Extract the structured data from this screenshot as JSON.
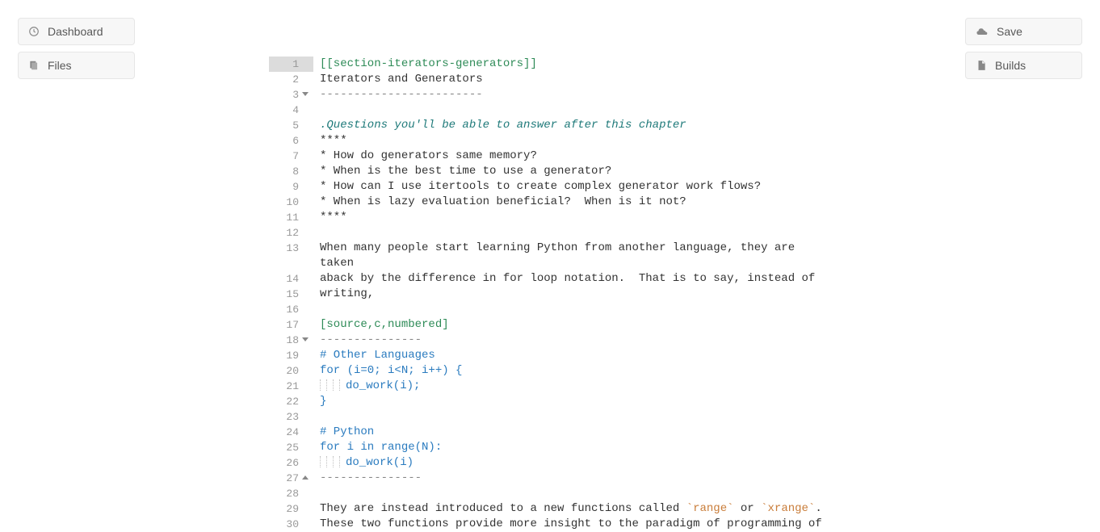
{
  "sidebar_left": {
    "dashboard_label": "Dashboard",
    "files_label": "Files"
  },
  "sidebar_right": {
    "save_label": "Save",
    "builds_label": "Builds"
  },
  "editor": {
    "active_line": 1,
    "lines": [
      {
        "n": 1,
        "segs": [
          {
            "t": "[[section-iterators-generators]]",
            "c": "tok-anchor"
          }
        ]
      },
      {
        "n": 2,
        "segs": [
          {
            "t": "Iterators and Generators"
          }
        ]
      },
      {
        "n": 3,
        "fold": "down",
        "segs": [
          {
            "t": "------------------------",
            "c": "tok-delim"
          }
        ]
      },
      {
        "n": 4,
        "segs": []
      },
      {
        "n": 5,
        "segs": [
          {
            "t": ".Questions you'll be able to answer after this chapter",
            "c": "tok-blocktitle"
          }
        ]
      },
      {
        "n": 6,
        "segs": [
          {
            "t": "****"
          }
        ]
      },
      {
        "n": 7,
        "segs": [
          {
            "t": "* How do generators same memory?"
          }
        ]
      },
      {
        "n": 8,
        "segs": [
          {
            "t": "* When is the best time to use a generator?"
          }
        ]
      },
      {
        "n": 9,
        "segs": [
          {
            "t": "* How can I use itertools to create complex generator work flows?"
          }
        ]
      },
      {
        "n": 10,
        "segs": [
          {
            "t": "* When is lazy evaluation beneficial?  When is it not?"
          }
        ]
      },
      {
        "n": 11,
        "segs": [
          {
            "t": "****"
          }
        ]
      },
      {
        "n": 12,
        "segs": []
      },
      {
        "n": 13,
        "segs": [
          {
            "t": "When many people start learning Python from another language, they are "
          }
        ]
      },
      {
        "n": 0,
        "cont": true,
        "segs": [
          {
            "t": "taken"
          }
        ]
      },
      {
        "n": 14,
        "segs": [
          {
            "t": "aback by the difference in for loop notation.  That is to say, instead of "
          }
        ]
      },
      {
        "n": 15,
        "segs": [
          {
            "t": "writing,"
          }
        ]
      },
      {
        "n": 16,
        "segs": []
      },
      {
        "n": 17,
        "segs": [
          {
            "t": "[source,c,numbered]",
            "c": "tok-source"
          }
        ]
      },
      {
        "n": 18,
        "fold": "down",
        "segs": [
          {
            "t": "---------------",
            "c": "tok-delim"
          }
        ]
      },
      {
        "n": 19,
        "segs": [
          {
            "t": "# Other Languages",
            "c": "tok-codeblock"
          }
        ]
      },
      {
        "n": 20,
        "segs": [
          {
            "t": "for (i=0; i<N; i++) {",
            "c": "tok-codeblock"
          }
        ]
      },
      {
        "n": 21,
        "indent": 1,
        "segs": [
          {
            "t": "do_work(i);",
            "c": "tok-codeblock"
          }
        ]
      },
      {
        "n": 22,
        "segs": [
          {
            "t": "}",
            "c": "tok-codeblock"
          }
        ]
      },
      {
        "n": 23,
        "segs": []
      },
      {
        "n": 24,
        "segs": [
          {
            "t": "# Python",
            "c": "tok-codeblock"
          }
        ]
      },
      {
        "n": 25,
        "segs": [
          {
            "t": "for i in range(N):",
            "c": "tok-codeblock"
          }
        ]
      },
      {
        "n": 26,
        "indent": 1,
        "segs": [
          {
            "t": "do_work(i)",
            "c": "tok-codeblock"
          }
        ]
      },
      {
        "n": 27,
        "fold": "up",
        "segs": [
          {
            "t": "---------------",
            "c": "tok-delim"
          }
        ]
      },
      {
        "n": 28,
        "segs": []
      },
      {
        "n": 29,
        "segs": [
          {
            "t": "They are instead introduced to a new functions called "
          },
          {
            "t": "`range`",
            "c": "tok-inline"
          },
          {
            "t": " or "
          },
          {
            "t": "`xrange`",
            "c": "tok-inline"
          },
          {
            "t": "."
          }
        ]
      },
      {
        "n": 30,
        "segs": [
          {
            "t": "These two functions provide more insight to the paradigm of programming of "
          }
        ]
      }
    ]
  }
}
